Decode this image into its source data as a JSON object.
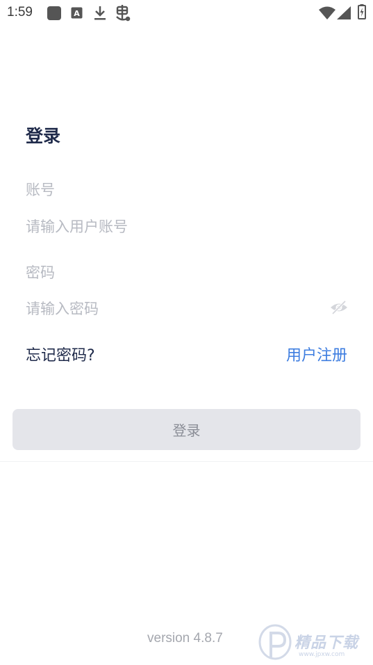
{
  "status_bar": {
    "time": "1:59",
    "left_icons": [
      "app-square-icon",
      "text-a-icon",
      "download-icon",
      "bug-icon"
    ],
    "right_icons": [
      "wifi-icon",
      "signal-icon",
      "battery-charging-icon"
    ]
  },
  "login": {
    "title": "登录",
    "account_label": "账号",
    "account_placeholder": "请输入用户账号",
    "password_label": "密码",
    "password_placeholder": "请输入密码",
    "forgot_password": "忘记密码?",
    "register": "用户注册",
    "submit_label": "登录"
  },
  "footer": {
    "version": "version 4.8.7"
  },
  "watermark": {
    "text": "精品下载",
    "url": "www.jpxw.com"
  },
  "colors": {
    "title": "#1f2a4a",
    "placeholder": "#b7bac2",
    "link": "#3d7de0",
    "button_bg": "#e4e5ea",
    "button_text": "#8a8d96"
  }
}
